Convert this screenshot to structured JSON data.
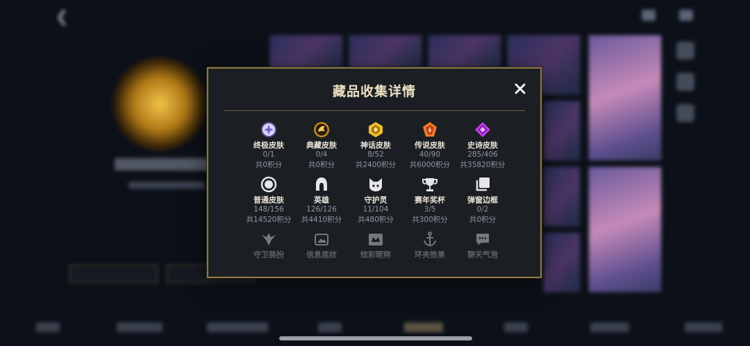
{
  "modal": {
    "title": "藏品收集详情",
    "close_label": "✕",
    "rows": [
      [
        {
          "name": "终极皮肤",
          "count": "0/1",
          "points": "共0积分",
          "icon": "ultimate-skin-icon",
          "color": "#b9a8f0"
        },
        {
          "name": "典藏皮肤",
          "count": "0/4",
          "points": "共0积分",
          "icon": "collector-skin-icon",
          "color": "#e8b04a"
        },
        {
          "name": "神话皮肤",
          "count": "8/52",
          "points": "共2400积分",
          "icon": "mythic-skin-icon",
          "color": "#f0c230"
        },
        {
          "name": "传说皮肤",
          "count": "40/90",
          "points": "共6000积分",
          "icon": "legendary-skin-icon",
          "color": "#f07a2a"
        },
        {
          "name": "史诗皮肤",
          "count": "285/406",
          "points": "共35820积分",
          "icon": "epic-skin-icon",
          "color": "#c23ee8"
        }
      ],
      [
        {
          "name": "普通皮肤",
          "count": "148/156",
          "points": "共14520积分",
          "icon": "normal-skin-icon",
          "color": "#e6e6e6"
        },
        {
          "name": "英雄",
          "count": "126/126",
          "points": "共4410积分",
          "icon": "hero-helmet-icon",
          "color": "#e6e6e6"
        },
        {
          "name": "守护灵",
          "count": "11/104",
          "points": "共480积分",
          "icon": "guardian-spirit-icon",
          "color": "#e6e6e6"
        },
        {
          "name": "赛年奖杯",
          "count": "3/5",
          "points": "共300积分",
          "icon": "trophy-icon",
          "color": "#e6e6e6"
        },
        {
          "name": "弹窗边框",
          "count": "0/2",
          "points": "共0积分",
          "icon": "popup-frame-icon",
          "color": "#e6e6e6"
        }
      ],
      [
        {
          "name": "守卫装扮",
          "icon": "ward-skin-icon"
        },
        {
          "name": "信息底纹",
          "icon": "info-background-icon"
        },
        {
          "name": "炫彩昵称",
          "icon": "colorful-nickname-icon"
        },
        {
          "name": "环夹效果",
          "icon": "anchor-effect-icon"
        },
        {
          "name": "聊天气泡",
          "icon": "chat-bubble-icon"
        }
      ]
    ]
  }
}
